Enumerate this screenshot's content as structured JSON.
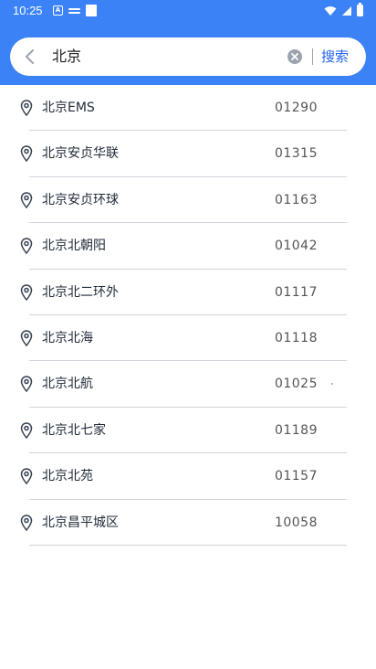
{
  "status_bar": {
    "time": "10:25"
  },
  "search": {
    "query": "北京",
    "button_label": "搜索"
  },
  "colors": {
    "header": "#3b82f6",
    "accent": "#2563eb"
  },
  "results": [
    {
      "name": "北京EMS",
      "code": "01290"
    },
    {
      "name": "北京安贞华联",
      "code": "01315"
    },
    {
      "name": "北京安贞环球",
      "code": "01163"
    },
    {
      "name": "北京北朝阳",
      "code": "01042"
    },
    {
      "name": "北京北二环外",
      "code": "01117"
    },
    {
      "name": "北京北海",
      "code": "01118"
    },
    {
      "name": "北京北航",
      "code": "01025"
    },
    {
      "name": "北京北七家",
      "code": "01189"
    },
    {
      "name": "北京北苑",
      "code": "01157"
    },
    {
      "name": "北京昌平城区",
      "code": "10058"
    }
  ]
}
